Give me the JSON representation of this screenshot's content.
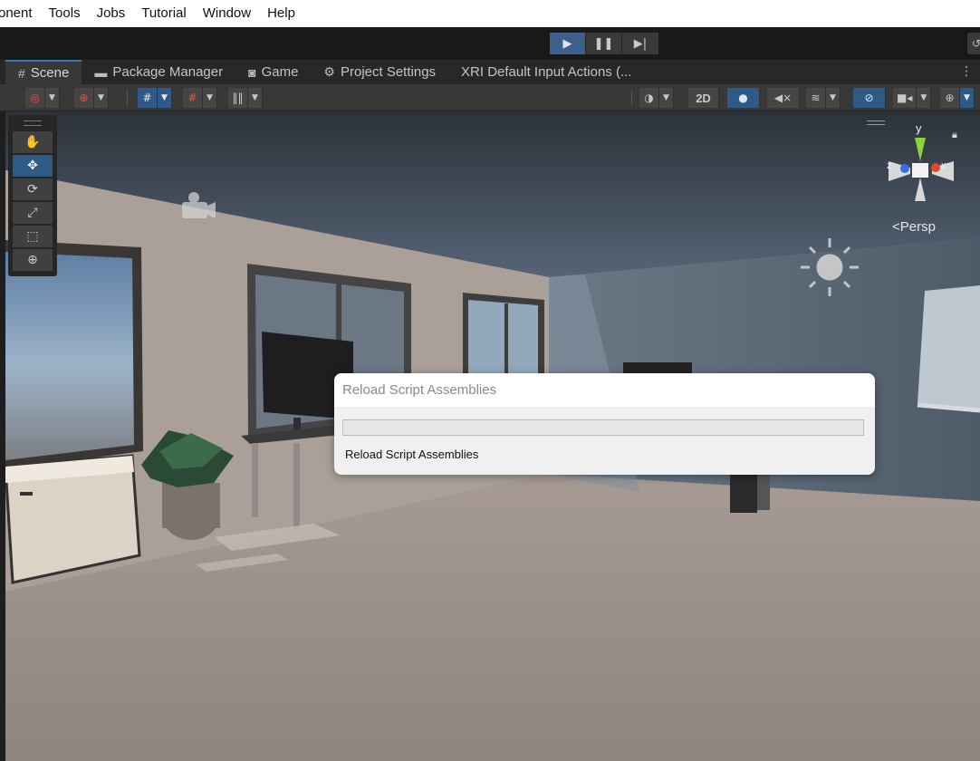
{
  "menu": [
    "onent",
    "Tools",
    "Jobs",
    "Tutorial",
    "Window",
    "Help"
  ],
  "playback": {
    "play_active": true
  },
  "tabs": [
    {
      "label": "Scene",
      "icon": "hash-icon",
      "active": true
    },
    {
      "label": "Package Manager",
      "icon": "package-icon"
    },
    {
      "label": "Game",
      "icon": "gamepad-icon"
    },
    {
      "label": "Project Settings",
      "icon": "gear-icon"
    },
    {
      "label": "XRI Default Input Actions (...",
      "icon": ""
    }
  ],
  "scene_toolbar": {
    "mode_2d": "2D"
  },
  "scene_view": {
    "projection": "Persp",
    "gizmo_axes": {
      "y": "y",
      "x": "x",
      "z": "z"
    }
  },
  "dialog": {
    "title": "Reload Script Assemblies",
    "status": "Reload Script Assemblies",
    "progress": 0
  },
  "colors": {
    "accent": "#3a79bb",
    "active_tool": "#2f5a86",
    "progress_fill": "#06b025"
  }
}
